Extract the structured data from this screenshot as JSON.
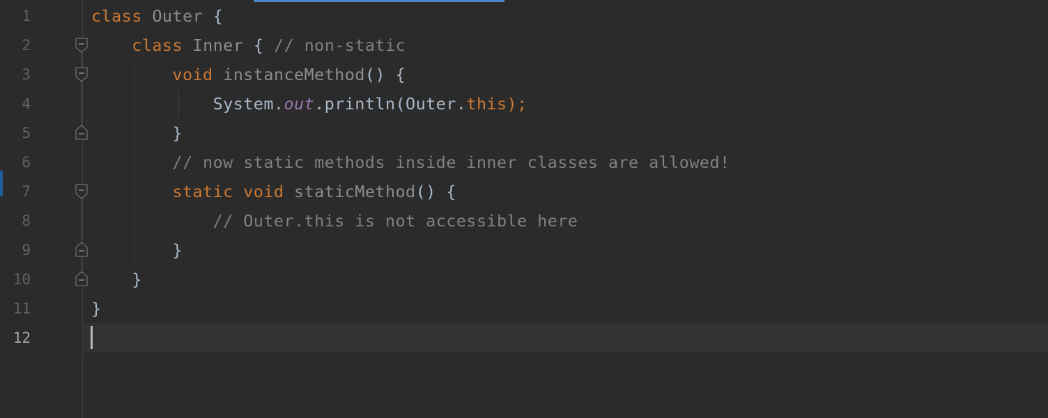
{
  "editor": {
    "language": "Java",
    "current_line": 12,
    "colors": {
      "background": "#2b2b2b",
      "current_line": "#323232",
      "keyword": "#cc7832",
      "identifier": "#a9b7c6",
      "comment": "#808080",
      "static_field": "#9876aa",
      "line_number": "#606366"
    },
    "line_numbers": [
      "1",
      "2",
      "3",
      "4",
      "5",
      "6",
      "7",
      "8",
      "9",
      "10",
      "11",
      "12"
    ],
    "code": {
      "l1": {
        "kw": "class",
        "name": "Outer",
        "brace": "{"
      },
      "l2": {
        "kw": "class",
        "name": "Inner",
        "brace": "{",
        "comment": "// non-static"
      },
      "l3": {
        "kw": "void",
        "name": "instanceMethod",
        "rest": "() {"
      },
      "l4": {
        "a": "System.",
        "field": "out",
        "b": ".println(Outer.",
        "kw": "this",
        "c": ");"
      },
      "l5": {
        "text": "}"
      },
      "l6": {
        "comment": "// now static methods inside inner classes are allowed!"
      },
      "l7": {
        "kw1": "static",
        "kw2": "void",
        "name": "staticMethod",
        "rest": "() {"
      },
      "l8": {
        "comment": "// Outer.this is not accessible here"
      },
      "l9": {
        "text": "}"
      },
      "l10": {
        "text": "}"
      },
      "l11": {
        "text": "}"
      }
    }
  }
}
